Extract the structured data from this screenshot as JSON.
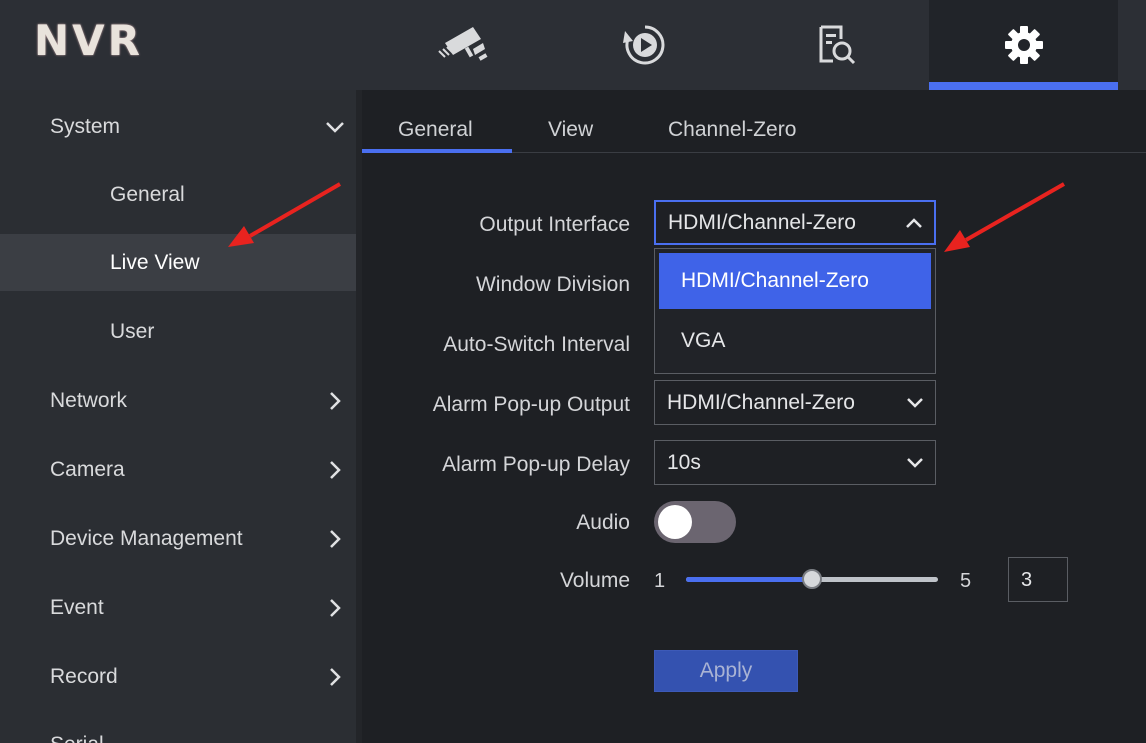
{
  "app": {
    "logo": "NVR"
  },
  "topnav": [
    {
      "name": "live-view-camera-icon",
      "active": false
    },
    {
      "name": "playback-icon",
      "active": false
    },
    {
      "name": "search-file-icon",
      "active": false
    },
    {
      "name": "settings-gear-icon",
      "active": true
    }
  ],
  "sidebar": {
    "items": [
      {
        "label": "System",
        "expanded": true
      },
      {
        "label": "General"
      },
      {
        "label": "Live View",
        "selected": true
      },
      {
        "label": "User"
      },
      {
        "label": "Network"
      },
      {
        "label": "Camera"
      },
      {
        "label": "Device Management"
      },
      {
        "label": "Event"
      },
      {
        "label": "Record"
      },
      {
        "label": "Serial"
      }
    ]
  },
  "tabs": [
    {
      "label": "General",
      "active": true
    },
    {
      "label": "View"
    },
    {
      "label": "Channel-Zero"
    }
  ],
  "form": {
    "output_interface": {
      "label": "Output Interface",
      "value": "HDMI/Channel-Zero"
    },
    "window_division": {
      "label": "Window Division"
    },
    "auto_switch_interval": {
      "label": "Auto-Switch Interval"
    },
    "alarm_popup_output": {
      "label": "Alarm Pop-up Output",
      "value": "HDMI/Channel-Zero"
    },
    "alarm_popup_delay": {
      "label": "Alarm Pop-up Delay",
      "value": "10s"
    },
    "audio": {
      "label": "Audio",
      "on": false
    },
    "volume": {
      "label": "Volume",
      "min": "1",
      "max": "5",
      "value": "3",
      "fraction": 0.5
    }
  },
  "dropdown": {
    "options": [
      "HDMI/Channel-Zero",
      "VGA"
    ],
    "selected": "HDMI/Channel-Zero"
  },
  "apply_label": "Apply",
  "colors": {
    "accent": "#4a6ff0",
    "annotation_arrow": "#e8231f",
    "topbar": "#2c2f35",
    "sidebar": "#2b2e33",
    "background": "#1e2024"
  }
}
